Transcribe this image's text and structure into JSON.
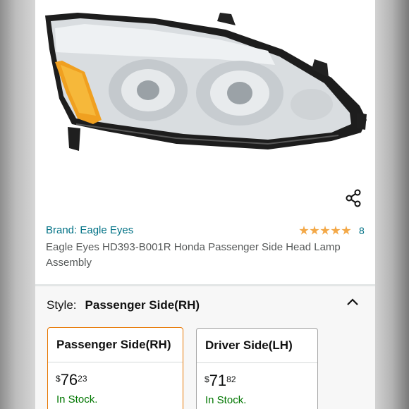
{
  "product": {
    "brand_label": "Brand: Eagle Eyes",
    "title": "Eagle Eyes HD393-B001R Honda Passenger Side Head Lamp Assembly",
    "rating_stars": 5,
    "rating_count": "8",
    "image_icon": "headlamp-assembly-photo"
  },
  "share": {
    "icon": "share-icon"
  },
  "style_section": {
    "label": "Style:",
    "value": "Passenger Side(RH)",
    "collapse_icon": "chevron-up-icon"
  },
  "options": [
    {
      "name": "Passenger Side(RH)",
      "price_symbol": "$",
      "price_whole": "76",
      "price_fraction": "23",
      "availability": "In Stock.",
      "selected": true
    },
    {
      "name": "Driver Side(LH)",
      "price_symbol": "$",
      "price_whole": "71",
      "price_fraction": "82",
      "availability": "In Stock.",
      "selected": false
    }
  ],
  "colors": {
    "link": "#007185",
    "star": "#f3a847",
    "in_stock": "#007600",
    "selected_border": "#e77600"
  }
}
